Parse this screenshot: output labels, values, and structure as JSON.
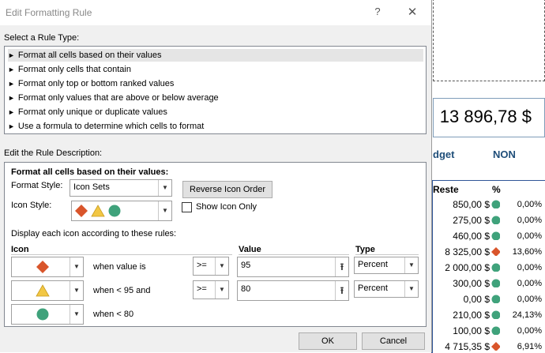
{
  "dialog": {
    "title": "Edit Formatting Rule",
    "help_glyph": "?",
    "close_glyph": "✕",
    "select_rule_label": "Select a Rule Type:",
    "rule_types": [
      "Format all cells based on their values",
      "Format only cells that contain",
      "Format only top or bottom ranked values",
      "Format only values that are above or below average",
      "Format only unique or duplicate values",
      "Use a formula to determine which cells to format"
    ],
    "selected_rule_index": 0,
    "edit_desc_label": "Edit the Rule Description:",
    "format_all_heading": "Format all cells based on their values:",
    "format_style_label": "Format Style:",
    "format_style_value": "Icon Sets",
    "reverse_btn": "Reverse Icon Order",
    "icon_style_label": "Icon Style:",
    "show_icon_only": "Show Icon Only",
    "show_icon_only_checked": false,
    "display_rules_label": "Display each icon according to these rules:",
    "col_icon": "Icon",
    "col_value": "Value",
    "col_type": "Type",
    "rules": [
      {
        "icon": "red-diamond-icon",
        "text": "when value is",
        "op": ">=",
        "value": "95",
        "type": "Percent"
      },
      {
        "icon": "yellow-triangle-icon",
        "text": "when < 95 and",
        "op": ">=",
        "value": "80",
        "type": "Percent"
      },
      {
        "icon": "green-circle-icon",
        "text": "when < 80"
      }
    ],
    "ok": "OK",
    "cancel": "Cancel"
  },
  "sheet": {
    "total": "13 896,78 $",
    "hdr_budget": "dget",
    "hdr_non": "NON",
    "col_reste": "Reste",
    "col_pct": "%",
    "rows": [
      {
        "reste": "850,00 $",
        "icon": "green",
        "pct": "0,00%"
      },
      {
        "reste": "275,00 $",
        "icon": "green",
        "pct": "0,00%"
      },
      {
        "reste": "460,00 $",
        "icon": "green",
        "pct": "0,00%"
      },
      {
        "reste": "8 325,00 $",
        "icon": "red",
        "pct": "13,60%"
      },
      {
        "reste": "2 000,00 $",
        "icon": "green",
        "pct": "0,00%"
      },
      {
        "reste": "300,00 $",
        "icon": "green",
        "pct": "0,00%"
      },
      {
        "reste": "0,00 $",
        "icon": "green",
        "pct": "0,00%"
      },
      {
        "reste": "210,00 $",
        "icon": "green",
        "pct": "24,13%"
      },
      {
        "reste": "100,00 $",
        "icon": "green",
        "pct": "0,00%"
      },
      {
        "reste": "4 715,35 $",
        "icon": "red",
        "pct": "6,91%"
      }
    ]
  },
  "colors": {
    "red": "#d9552b",
    "yellow": "#f2c744",
    "green": "#3fa27b"
  }
}
